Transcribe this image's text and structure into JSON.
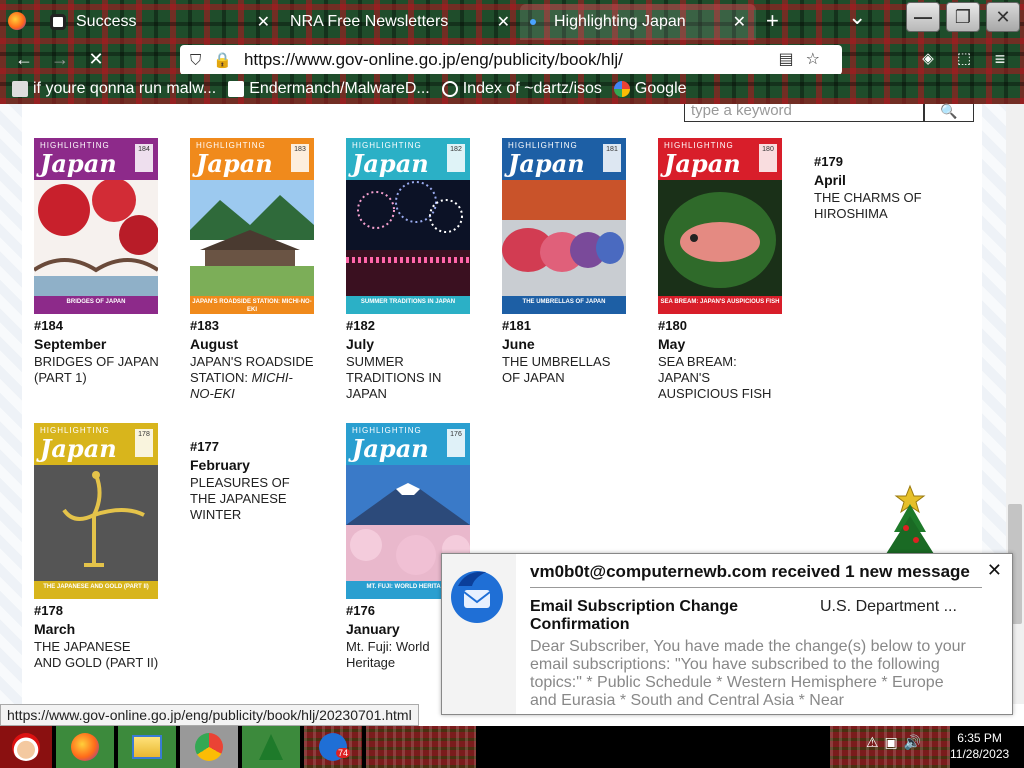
{
  "browser": {
    "tabs": [
      {
        "label": "Success",
        "active": false
      },
      {
        "label": "NRA Free Newsletters",
        "active": false
      },
      {
        "label": "Highlighting Japan",
        "active": true
      }
    ],
    "new_tab": "+",
    "tab_list": "⌄",
    "window_controls": {
      "minimize": "—",
      "restore": "❐",
      "close": "✕"
    },
    "url": "https://www.gov-online.go.jp/eng/publicity/book/hlj/",
    "bookmarks": [
      {
        "label": "if youre qonna run malw...",
        "icon": "bookmark-icon"
      },
      {
        "label": "Endermanch/MalwareD...",
        "icon": "github-icon"
      },
      {
        "label": "Index of ~dartz/isos",
        "icon": "globe-icon"
      },
      {
        "label": "Google",
        "icon": "google-icon"
      }
    ]
  },
  "page": {
    "search_placeholder": "type a keyword",
    "issues": [
      {
        "number": "#184",
        "month": "September",
        "title": "BRIDGES OF JAPAN (PART 1)",
        "cover_color": "#8d2a8a",
        "footer_text": "BRIDGES OF JAPAN <PART 1>",
        "footer_color": "#8d2a8a",
        "has_cover": true,
        "art": "bridge-red-leaves"
      },
      {
        "number": "#183",
        "month": "August",
        "title": "JAPAN'S ROADSIDE STATION:",
        "title_italic": "MICHI-NO-EKI",
        "cover_color": "#f08a1c",
        "footer_text": "JAPAN'S ROADSIDE STATION: MICHI-NO-EKI",
        "footer_color": "#f08a1c",
        "has_cover": true,
        "art": "roadside-station"
      },
      {
        "number": "#182",
        "month": "July",
        "title": "SUMMER TRADITIONS IN JAPAN",
        "cover_color": "#2bb0c6",
        "footer_text": "SUMMER TRADITIONS IN JAPAN",
        "footer_color": "#2bb0c6",
        "has_cover": true,
        "art": "fireworks"
      },
      {
        "number": "#181",
        "month": "June",
        "title": "THE UMBRELLAS OF JAPAN",
        "cover_color": "#1d5fa5",
        "footer_text": "THE UMBRELLAS OF JAPAN",
        "footer_color": "#1d5fa5",
        "has_cover": true,
        "art": "umbrellas"
      },
      {
        "number": "#180",
        "month": "May",
        "title": "SEA BREAM: JAPAN'S AUSPICIOUS FISH",
        "cover_color": "#d81e2a",
        "footer_text": "SEA BREAM: JAPAN'S AUSPICIOUS FISH",
        "footer_color": "#d81e2a",
        "has_cover": true,
        "art": "sea-bream"
      },
      {
        "number": "#179",
        "month": "April",
        "title": "THE CHARMS OF HIROSHIMA",
        "has_cover": false
      },
      {
        "number": "#178",
        "month": "March",
        "title": "THE JAPANESE AND GOLD (PART II)",
        "cover_color": "#d8b51c",
        "footer_text": "THE JAPANESE AND GOLD (PART II)",
        "footer_color": "#d8b51c",
        "has_cover": true,
        "art": "gold-crane"
      },
      {
        "number": "#177",
        "month": "February",
        "title": "PLEASURES OF THE JAPANESE WINTER",
        "has_cover": false
      },
      {
        "number": "#176",
        "month": "January",
        "title": "Mt. Fuji: World Heritage",
        "cover_color": "#2a9fd0",
        "footer_text": "MT. FUJI: WORLD HERITAGE",
        "footer_color": "#2a9fd0",
        "has_cover": true,
        "art": "mt-fuji"
      }
    ],
    "cover_brand_small": "HIGHLIGHTING",
    "cover_brand": "Japan"
  },
  "status_url": "https://www.gov-online.go.jp/eng/publicity/book/hlj/20230701.html",
  "notification": {
    "header": "vm0b0t@computernewb.com received 1 new message",
    "subject": "Email Subscription Change Confirmation",
    "sender": "U.S. Department ...",
    "body": "Dear Subscriber, You have made the change(s) below to your email subscriptions: \"You have subscribed to the following topics:\" * Public Schedule * Western Hemisphere * Europe and Eurasia * South and Central Asia * Near",
    "close": "✕"
  },
  "taskbar": {
    "thunderbird_badge": "74",
    "time": "6:35 PM",
    "date": "11/28/2023"
  }
}
